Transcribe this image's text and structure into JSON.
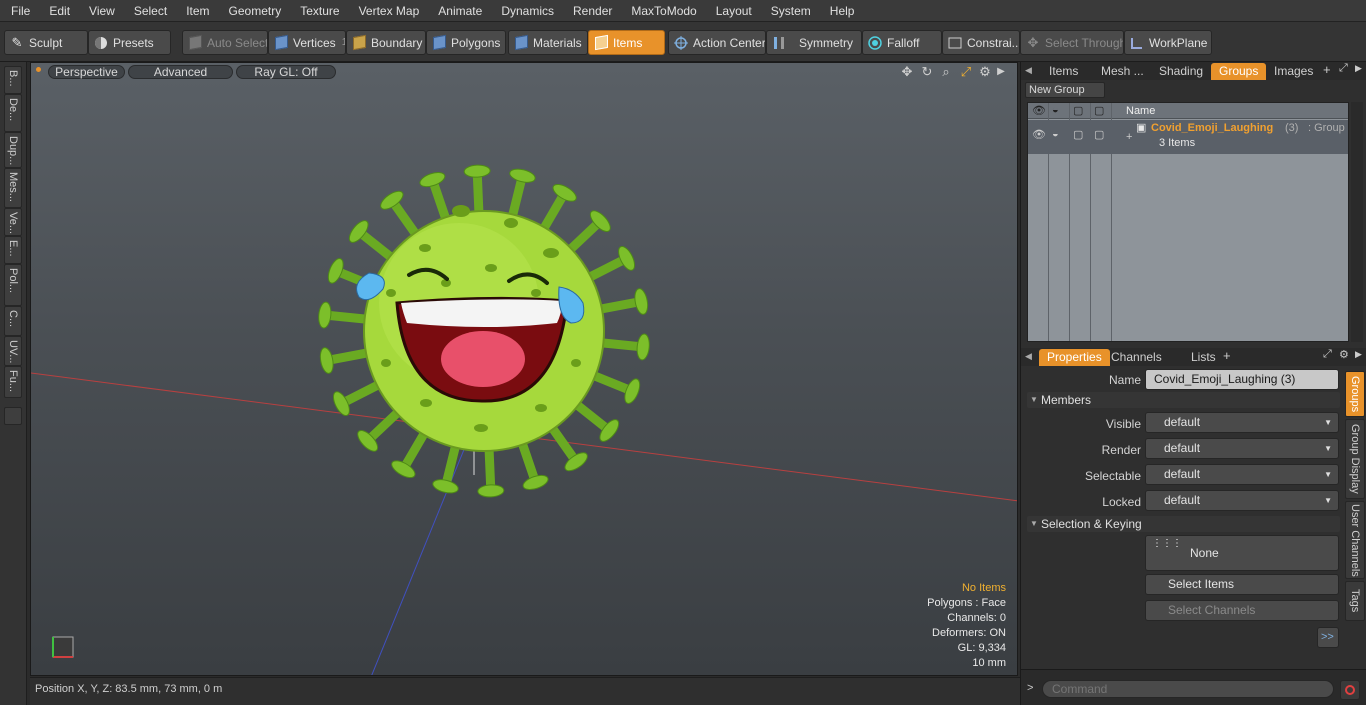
{
  "menu": [
    "File",
    "Edit",
    "View",
    "Select",
    "Item",
    "Geometry",
    "Texture",
    "Vertex Map",
    "Animate",
    "Dynamics",
    "Render",
    "MaxToModo",
    "Layout",
    "System",
    "Help"
  ],
  "toolbar": {
    "sculpt": "Sculpt",
    "presets": "Presets",
    "auto_select": "Auto Select",
    "vertices": "Vertices",
    "vertices_count": "1",
    "boundary": "Boundary",
    "polygons": "Polygons",
    "materials": "Materials",
    "items": "Items",
    "action_center": "Action Center",
    "symmetry": "Symmetry",
    "falloff": "Falloff",
    "constraints": "Constrai...",
    "select_through": "Select Through",
    "workplane": "WorkPlane"
  },
  "left_tabs": [
    "B...",
    "De...",
    "Dup...",
    "Mes...",
    "Ve...",
    "E...",
    "Pol...",
    "C...",
    "UV...",
    "Fu..."
  ],
  "viewport": {
    "view_mode": "Perspective",
    "shading": "Advanced",
    "raygl": "Ray GL: Off",
    "info": {
      "selection": "No Items",
      "polygons": "Polygons : Face",
      "channels": "Channels: 0",
      "deformers": "Deformers: ON",
      "gl": "GL: 9,334",
      "scale": "10 mm"
    }
  },
  "status": {
    "position": "Position X, Y, Z:  83.5 mm, 73 mm, 0 m"
  },
  "top_panel": {
    "tabs": [
      "Items",
      "Mesh ...",
      "Shading",
      "Groups",
      "Images"
    ],
    "active_tab": "Groups",
    "new_group": "New Group",
    "col_name": "Name",
    "group": {
      "name": "Covid_Emoji_Laughing",
      "count": "(3)",
      "type": ": Group",
      "items": "3 Items"
    }
  },
  "props_panel": {
    "tabs": [
      "Properties",
      "Channels",
      "Lists"
    ],
    "active_tab": "Properties",
    "name_label": "Name",
    "name_value": "Covid_Emoji_Laughing (3)",
    "members_section": "Members",
    "visible_label": "Visible",
    "visible_value": "default",
    "render_label": "Render",
    "render_value": "default",
    "selectable_label": "Selectable",
    "selectable_value": "default",
    "locked_label": "Locked",
    "locked_value": "default",
    "selkey_section": "Selection & Keying",
    "none_label": "None",
    "select_items": "Select Items",
    "select_channels": "Select Channels",
    "more": ">>",
    "side_tabs": [
      "Groups",
      "Group Display",
      "User Channels",
      "Tags"
    ],
    "command_placeholder": "Command"
  },
  "colors": {
    "accent": "#e8922a",
    "virus_green": "#9cd43a",
    "group_name": "#f0a030"
  }
}
